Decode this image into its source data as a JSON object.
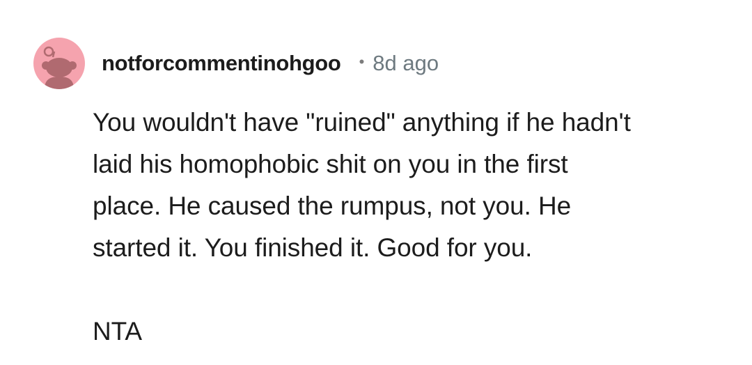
{
  "comment": {
    "avatar_icon": "reddit-snoo-avatar-icon",
    "avatar_color": "#f5a3ae",
    "username": "notforcommentinohgoo",
    "separator": "•",
    "time_ago": "8d ago",
    "body": {
      "paragraph1_lines": [
        "You wouldn't have \"ruined\" anything if he hadn't",
        "laid his homophobic shit on you in the first",
        "place. He caused the rumpus, not you. He",
        "started it. You finished it. Good for you."
      ],
      "paragraph2": "NTA"
    }
  }
}
